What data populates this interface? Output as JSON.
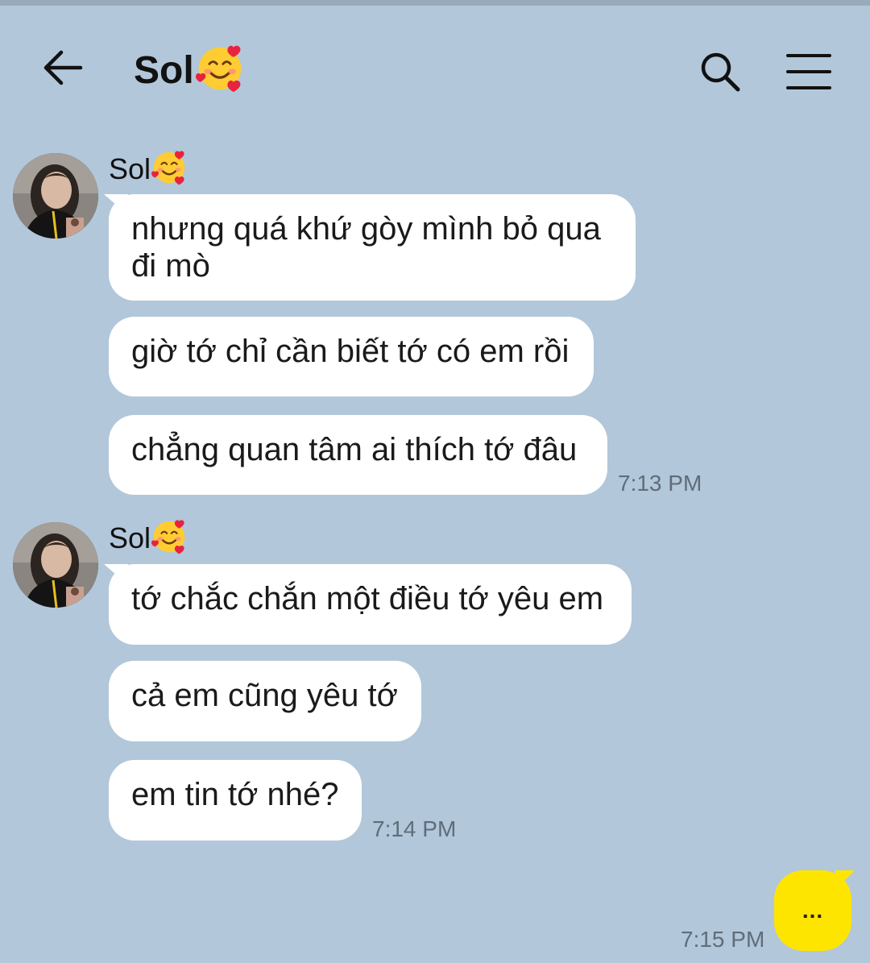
{
  "header": {
    "title": "Sol",
    "title_emoji": "smiling-face-with-hearts-emoji",
    "icons": [
      "back-arrow-icon",
      "search-icon",
      "menu-icon"
    ]
  },
  "colors": {
    "background": "#b2c7da",
    "incoming_bubble": "#ffffff",
    "outgoing_bubble": "#fee500"
  },
  "groups": [
    {
      "sender": "Sol",
      "messages": [
        "nhưng quá khứ gòy mình bỏ qua đi mò",
        "giờ tớ chỉ cần biết tớ có em rồi",
        "chẳng quan tâm ai thích tớ đâu"
      ],
      "time": "7:13 PM"
    },
    {
      "sender": "Sol",
      "messages": [
        "tớ chắc chắn một điều tớ yêu em",
        "cả em cũng yêu tớ",
        "em tin tớ nhé?"
      ],
      "time": "7:14 PM"
    }
  ],
  "outgoing": {
    "text": "...",
    "time": "7:15 PM"
  }
}
